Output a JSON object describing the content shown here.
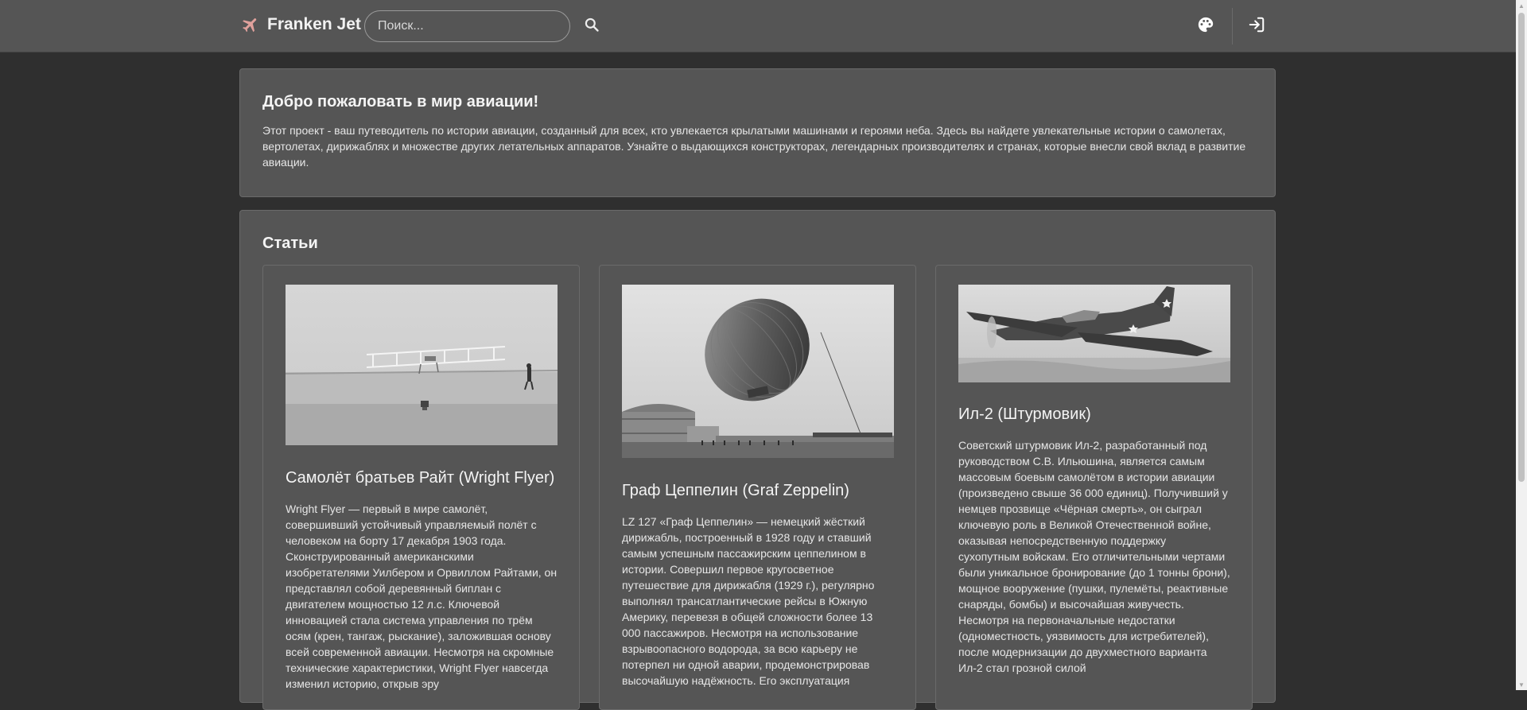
{
  "header": {
    "brand_name": "Franken Jet",
    "brand_icon": "airplane-icon",
    "brand_icon_color": "#e0a19c",
    "search_placeholder": "Поиск...",
    "search_value": "",
    "search_icon": "search-icon",
    "theme_icon": "palette-icon",
    "login_icon": "login-icon"
  },
  "welcome": {
    "title": "Добро пожаловать в мир авиации!",
    "text": "Этот проект - ваш путеводитель по истории авиации, созданный для всех, кто увлекается крылатыми машинами и героями неба. Здесь вы найдете увлекательные истории о самолетах, вертолетах, дирижаблях и множестве других летательных аппаратов. Узнайте о выдающихся конструкторах, легендарных производителях и странах, которые внесли свой вклад в развитие авиации."
  },
  "articles": {
    "title": "Статьи",
    "cards": [
      {
        "title": "Самолёт братьев Райт (Wright Flyer)",
        "text": "Wright Flyer — первый в мире самолёт, совершивший устойчивый управляемый полёт с человеком на борту 17 декабря 1903 года. Сконструированный американскими изобретателями Уилбером и Орвиллом Райтами, он представлял собой деревянный биплан с двигателем мощностью 12 л.с. Ключевой инновацией стала система управления по трём осям (крен, тангаж, рыскание), заложившая основу всей современной авиации. Несмотря на скромные технические характеристики, Wright Flyer навсегда изменил историю, открыв эру"
      },
      {
        "title": "Граф Цеппелин (Graf Zeppelin)",
        "text": "LZ 127 «Граф Цеппелин» — немецкий жёсткий дирижабль, построенный в 1928 году и ставший самым успешным пассажирским цеппелином в истории. Совершил первое кругосветное путешествие для дирижабля (1929 г.), регулярно выполнял трансатлантические рейсы в Южную Америку, перевезя в общей сложности более 13 000 пассажиров. Несмотря на использование взрывоопасного водорода, за всю карьеру не потерпел ни одной аварии, продемонстрировав высочайшую надёжность. Его эксплуатация"
      },
      {
        "title": "Ил-2 (Штурмовик)",
        "text": "Советский штурмовик Ил-2, разработанный под руководством С.В. Ильюшина, является самым массовым боевым самолётом в истории авиации (произведено свыше 36 000 единиц). Получивший у немцев прозвище «Чёрная смерть», он сыграл ключевую роль в Великой Отечественной войне, оказывая непосредственную поддержку сухопутным войскам. Его отличительными чертами были уникальное бронирование (до 1 тонны брони), мощное вооружение (пушки, пулемёты, реактивные снаряды, бомбы) и высочайшая живучесть. Несмотря на первоначальные недостатки (одноместность, уязвимость для истребителей), после модернизации до двухместного варианта Ил-2 стал грозной силой"
      }
    ]
  }
}
